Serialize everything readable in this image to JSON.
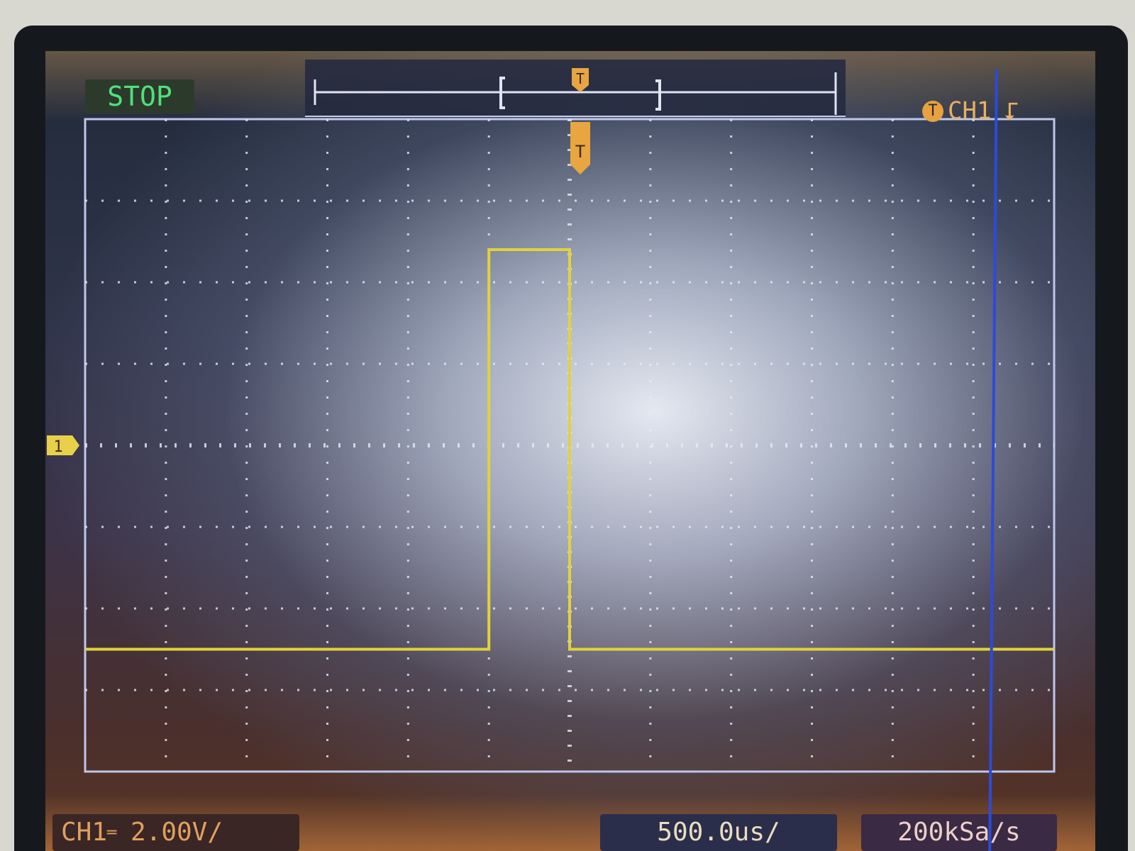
{
  "status": {
    "run_state": "STOP"
  },
  "trigger": {
    "marker_label": "T",
    "source": "CH1",
    "slope_symbol": "⮦"
  },
  "channel1": {
    "marker_label": "1",
    "scale_prefix": "CH1",
    "coupling_symbol": "═",
    "scale": "2.00V/"
  },
  "horizontal": {
    "timebase": "500.0us/",
    "sample_rate": "200kSa/s"
  },
  "colors": {
    "trace": "#e2d23a",
    "grid": "#e6ecf6",
    "border": "#bfc6ea",
    "marker": "#e8a540",
    "run_state": "#4fe07a",
    "cursor": "#2d4ad8"
  },
  "chart_data": {
    "type": "line",
    "grid": true,
    "grid_divisions": {
      "x": 12,
      "y": 8
    },
    "x_unit": "div",
    "y_unit": "div",
    "xlim": [
      -6,
      6
    ],
    "ylim": [
      -4,
      4
    ],
    "series": [
      {
        "x": [
          -6,
          -1,
          -1,
          0,
          0,
          6
        ],
        "y": [
          -2.5,
          -2.5,
          2.4,
          2.4,
          -2.5,
          -2.5
        ]
      }
    ],
    "ground_marker_y": 0,
    "trigger_position_x": 0
  }
}
